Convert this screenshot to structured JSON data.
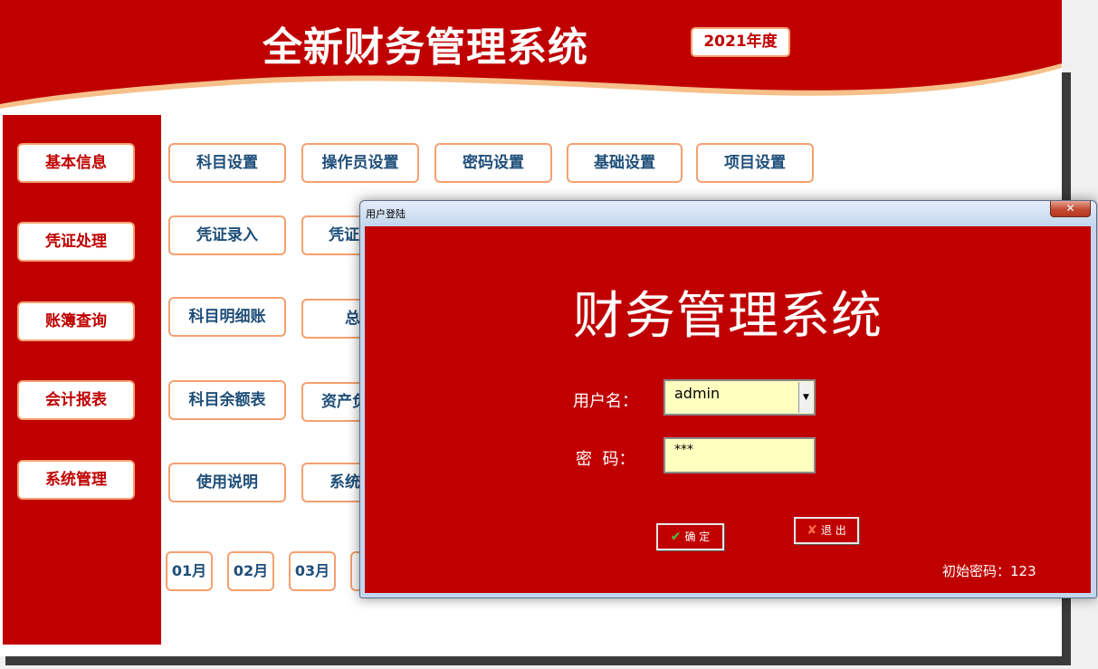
{
  "header": {
    "title": "全新财务管理系统",
    "year_badge": "2021年度"
  },
  "sidebar": {
    "items": [
      {
        "label": "基本信息"
      },
      {
        "label": "凭证处理"
      },
      {
        "label": "账簿查询"
      },
      {
        "label": "会计报表"
      },
      {
        "label": "系统管理"
      }
    ]
  },
  "functions": {
    "row1": [
      "科目设置",
      "操作员设置",
      "密码设置",
      "基础设置",
      "项目设置"
    ],
    "row2": [
      "凭证录入",
      "凭证"
    ],
    "row3": [
      "科目明细账",
      "总"
    ],
    "row4": [
      "科目余额表",
      "资产负"
    ],
    "row5": [
      "使用说明",
      "系统"
    ]
  },
  "months": [
    "01月",
    "02月",
    "03月"
  ],
  "dialog": {
    "window_title": "用户登陆",
    "close_label": "✕",
    "heading": "财务管理系统",
    "username_label": "用户名：",
    "username_value": "admin",
    "password_label": "密  码：",
    "password_value": "***",
    "confirm_label": "确 定",
    "exit_label": "退 出",
    "hint": "初始密码：123"
  },
  "colors": {
    "brand_red": "#c00000",
    "border_orange": "#f4a070",
    "input_yellow": "#ffffc0",
    "button_text_blue": "#1f4e79"
  },
  "icons": {
    "confirm": "check-icon",
    "exit": "x-icon",
    "dropdown": "chevron-down-icon"
  }
}
